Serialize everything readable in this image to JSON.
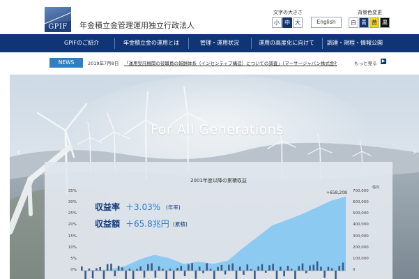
{
  "header": {
    "logo_text": "GPIF",
    "org_name": "年金積立金管理運用独立行政法人",
    "font_size": {
      "label": "文字の大きさ",
      "options": [
        "小",
        "中",
        "大"
      ],
      "active": "中"
    },
    "language_button": "English",
    "background": {
      "label": "背景色変更",
      "options": [
        {
          "label": "白",
          "bg": "#ffffff",
          "fg": "#333333"
        },
        {
          "label": "青",
          "bg": "#12336e",
          "fg": "#ffffff"
        },
        {
          "label": "黄",
          "bg": "#f3d21a",
          "fg": "#333333"
        },
        {
          "label": "黒",
          "bg": "#111111",
          "fg": "#ffffff"
        }
      ]
    }
  },
  "nav": {
    "items": [
      "GPIFのご紹介",
      "年金積立金の運用とは",
      "管理・運用状況",
      "運用の高度化に向けて",
      "調達・規程・情報公開"
    ]
  },
  "news": {
    "badge": "NEWS",
    "date": "2019年7月8日",
    "headline": "「運用受託機関の役職員の報酬体系（インセンティブ構造）についての調査」（マーサージャパン株式会社）を掲載しました",
    "more": "もっと見る"
  },
  "hero": {
    "tagline": "For All Generations",
    "prev_arrow": "‹",
    "next_arrow": "›"
  },
  "metrics": {
    "yield_label": "収益率",
    "yield_value": "＋3.03%",
    "yield_note": "(年率)",
    "amount_label": "収益額",
    "amount_value": "＋65.8兆円",
    "amount_note": "(累積)"
  },
  "colors": {
    "navy": "#0f3575",
    "news_badge": "#2f7fc2",
    "area_fill": "#7ec5f2",
    "bar_fill": "#3d5a86"
  },
  "chart_data": {
    "type": "area",
    "title": "2001年度以降の累積収益",
    "right_unit": "億円",
    "peak_label": "+658,208",
    "left_axis": {
      "ticks": [
        "35%",
        "30%",
        "25%",
        "20%",
        "15%",
        "10%",
        "5%",
        "0%"
      ],
      "ylim": [
        0,
        35
      ]
    },
    "right_axis": {
      "ticks": [
        "700,000",
        "600,000",
        "500,000",
        "400,000",
        "300,000",
        "200,000",
        "100,000",
        "0"
      ],
      "ylim": [
        0,
        700000
      ]
    },
    "series": [
      {
        "name": "累積収益",
        "values": [
          0,
          5000,
          10000,
          40000,
          100000,
          140000,
          110000,
          60000,
          80000,
          60000,
          90000,
          200000,
          300000,
          400000,
          450000,
          500000,
          560000,
          620000,
          658208
        ]
      }
    ]
  }
}
